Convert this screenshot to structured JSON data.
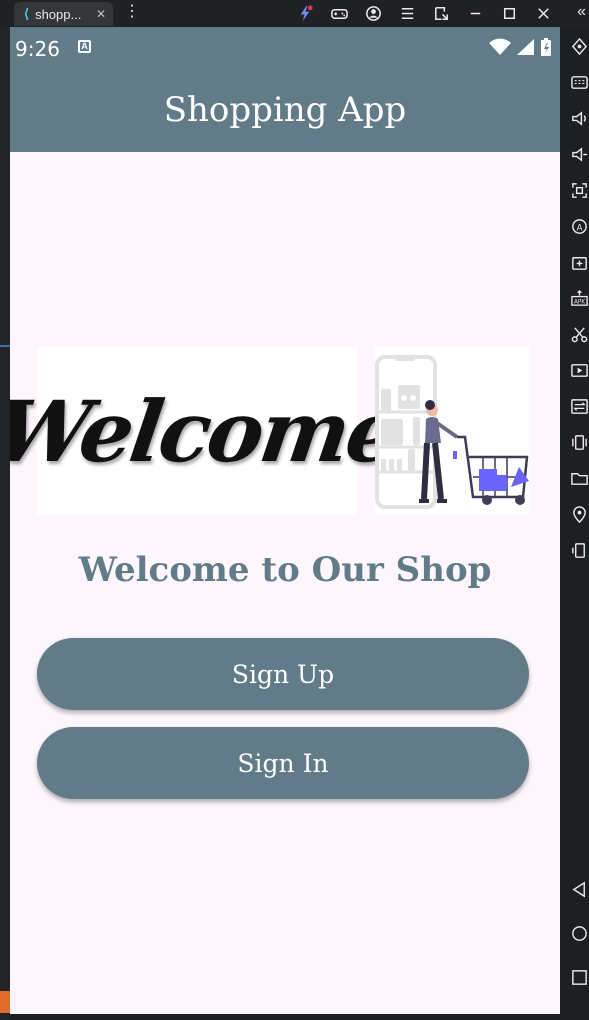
{
  "window": {
    "tab_title": "shopp...",
    "tab_close": "✕",
    "menu_glyph": "⋮",
    "collapse_glyph": "«",
    "title_icons": [
      "flutter-inspector-icon",
      "gamepad-icon",
      "account-icon",
      "hamburger-menu-icon",
      "screen-snip-icon",
      "minimize-icon",
      "maximize-icon",
      "close-icon"
    ]
  },
  "status_bar": {
    "time": "9:26",
    "notification_glyph": "A"
  },
  "app_bar": {
    "title": "Shopping App"
  },
  "banner": {
    "welcome_text": "Welcome"
  },
  "main": {
    "heading": "Welcome to Our Shop",
    "sign_up_label": "Sign Up",
    "sign_in_label": "Sign In"
  },
  "colors": {
    "primary": "#617b88",
    "background": "#fdf6fd",
    "accent_purple": "#6c63ff"
  },
  "sidebar_icons": [
    "rotate-icon",
    "keyboard-icon",
    "volume-up-icon",
    "volume-down-icon",
    "screenshot-icon",
    "auto-rotate-icon",
    "add-app-icon",
    "apk-install-icon",
    "cut-icon",
    "record-icon",
    "transfer-icon",
    "shake-icon",
    "folder-icon",
    "location-icon",
    "phone-icon",
    "back-icon",
    "home-icon",
    "recents-icon"
  ]
}
